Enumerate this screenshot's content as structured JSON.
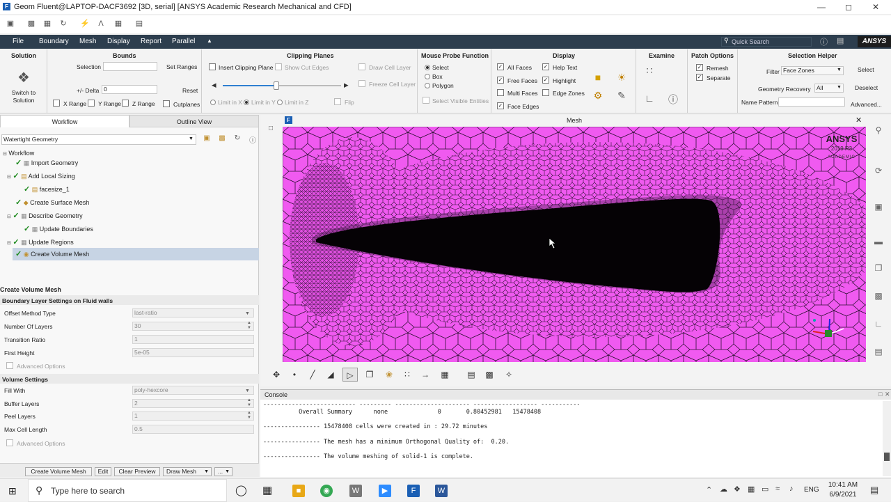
{
  "window": {
    "title": "Geom Fluent@LAPTOP-DACF3692  [3D, serial] [ANSYS Academic Research Mechanical and CFD]"
  },
  "menubar": {
    "items": [
      "File",
      "Boundary",
      "Mesh",
      "Display",
      "Report",
      "Parallel"
    ],
    "quick_search_placeholder": "Quick Search",
    "logo": "ANSYS"
  },
  "ribbon": {
    "solution": {
      "title": "Solution",
      "switch_label": "Switch to Solution"
    },
    "bounds": {
      "title": "Bounds",
      "selection_label": "Selection",
      "set_ranges": "Set Ranges",
      "delta_label": "+/- Delta",
      "delta_value": "0",
      "reset": "Reset",
      "x_range": "X Range",
      "y_range": "Y Range",
      "z_range": "Z Range",
      "cutplanes": "Cutplanes"
    },
    "clipping": {
      "title": "Clipping Planes",
      "insert": "Insert Clipping Plane",
      "show_cut_edges": "Show Cut Edges",
      "draw_cell_layer": "Draw Cell Layer",
      "freeze_cell_layer": "Freeze Cell Layer",
      "limit_x": "Limit in X",
      "limit_y": "Limit in Y",
      "limit_z": "Limit in Z",
      "flip": "Flip",
      "slider_value": 0.45
    },
    "probe": {
      "title": "Mouse Probe Function",
      "select": "Select",
      "box": "Box",
      "polygon": "Polygon",
      "select_visible": "Select Visible Entities"
    },
    "display": {
      "title": "Display",
      "all_faces": "All Faces",
      "free_faces": "Free Faces",
      "multi_faces": "Multi Faces",
      "face_edges": "Face Edges",
      "help_text": "Help Text",
      "highlight": "Highlight",
      "edge_zones": "Edge Zones"
    },
    "examine": {
      "title": "Examine"
    },
    "patch": {
      "title": "Patch Options",
      "remesh": "Remesh",
      "separate": "Separate"
    },
    "selection_helper": {
      "title": "Selection Helper",
      "filter_label": "Filter",
      "filter_value": "Face Zones",
      "select": "Select",
      "geometry_recovery": "Geometry Recovery",
      "geometry_recovery_value": "All",
      "deselect": "Deselect",
      "name_pattern": "Name Pattern",
      "advanced": "Advanced..."
    }
  },
  "left_panel": {
    "tabs": [
      "Workflow",
      "Outline View"
    ],
    "workflow_select": "Watertight Geometry",
    "tree": [
      {
        "label": "Workflow",
        "level": 0
      },
      {
        "label": "Import Geometry",
        "level": 1
      },
      {
        "label": "Add Local Sizing",
        "level": 1
      },
      {
        "label": "facesize_1",
        "level": 2
      },
      {
        "label": "Create Surface Mesh",
        "level": 1
      },
      {
        "label": "Describe Geometry",
        "level": 1
      },
      {
        "label": "Update Boundaries",
        "level": 2
      },
      {
        "label": "Update Regions",
        "level": 1
      },
      {
        "label": "Create Volume Mesh",
        "level": 1
      }
    ],
    "task_title": "Create Volume Mesh",
    "bl_section": "Boundary Layer Settings on Fluid walls",
    "bl_props": [
      {
        "label": "Offset Method Type",
        "value": "last-ratio"
      },
      {
        "label": "Number Of Layers",
        "value": "30"
      },
      {
        "label": "Transition Ratio",
        "value": "1"
      },
      {
        "label": "First Height",
        "value": "5e-05"
      }
    ],
    "advanced_options": "Advanced Options",
    "vol_section": "Volume Settings",
    "vol_props": [
      {
        "label": "Fill With",
        "value": "poly-hexcore"
      },
      {
        "label": "Buffer Layers",
        "value": "2"
      },
      {
        "label": "Peel Layers",
        "value": "1"
      },
      {
        "label": "Max Cell Length",
        "value": "0.5"
      }
    ],
    "buttons": [
      "Create Volume Mesh",
      "Edit",
      "Clear Preview",
      "Draw Mesh",
      "..."
    ]
  },
  "viewport": {
    "title": "Mesh",
    "watermark_brand": "ANSYS",
    "watermark_version": "2019 R3",
    "watermark_edition": "ACADEMIC"
  },
  "console": {
    "title": "Console",
    "lines": [
      "-------------------------- --------- --------------------- ------------------ -----------",
      "          Overall Summary      none              0       0.80452981   15478408",
      "",
      "---------------- 15478408 cells were created in : 29.72 minutes",
      "",
      "---------------- The mesh has a minimum Orthogonal Quality of:  0.20.",
      "",
      "---------------- The volume meshing of solid-1 is complete."
    ]
  },
  "taskbar": {
    "search_placeholder": "Type here to search",
    "lang": "ENG",
    "time": "10:41 AM",
    "date": "6/9/2021"
  },
  "colors": {
    "mesh_fill": "#f05af0",
    "mesh_line": "#2a1030",
    "menubar": "#2d3e4e"
  }
}
